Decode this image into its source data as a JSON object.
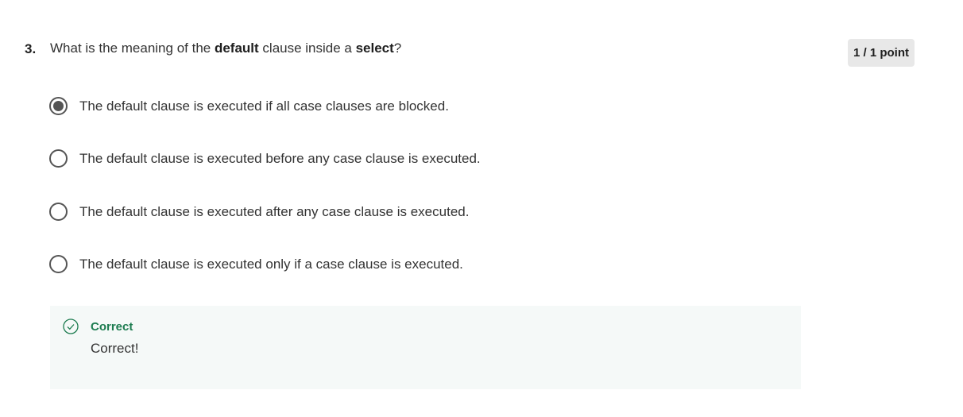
{
  "question": {
    "number": "3.",
    "text_pre": "What is the meaning of the ",
    "bold1": "default",
    "text_mid": " clause inside a ",
    "bold2": "select",
    "text_post": "?"
  },
  "score": "1 / 1 point",
  "options": [
    {
      "label": "The default clause is executed if all case clauses are blocked.",
      "selected": true
    },
    {
      "label": "The default clause is executed before any case clause is executed.",
      "selected": false
    },
    {
      "label": "The default clause is executed after any case clause is executed.",
      "selected": false
    },
    {
      "label": "The default clause is executed only if a case clause is executed.",
      "selected": false
    }
  ],
  "feedback": {
    "title": "Correct",
    "message": "Correct!",
    "color": "#1d7c50"
  }
}
